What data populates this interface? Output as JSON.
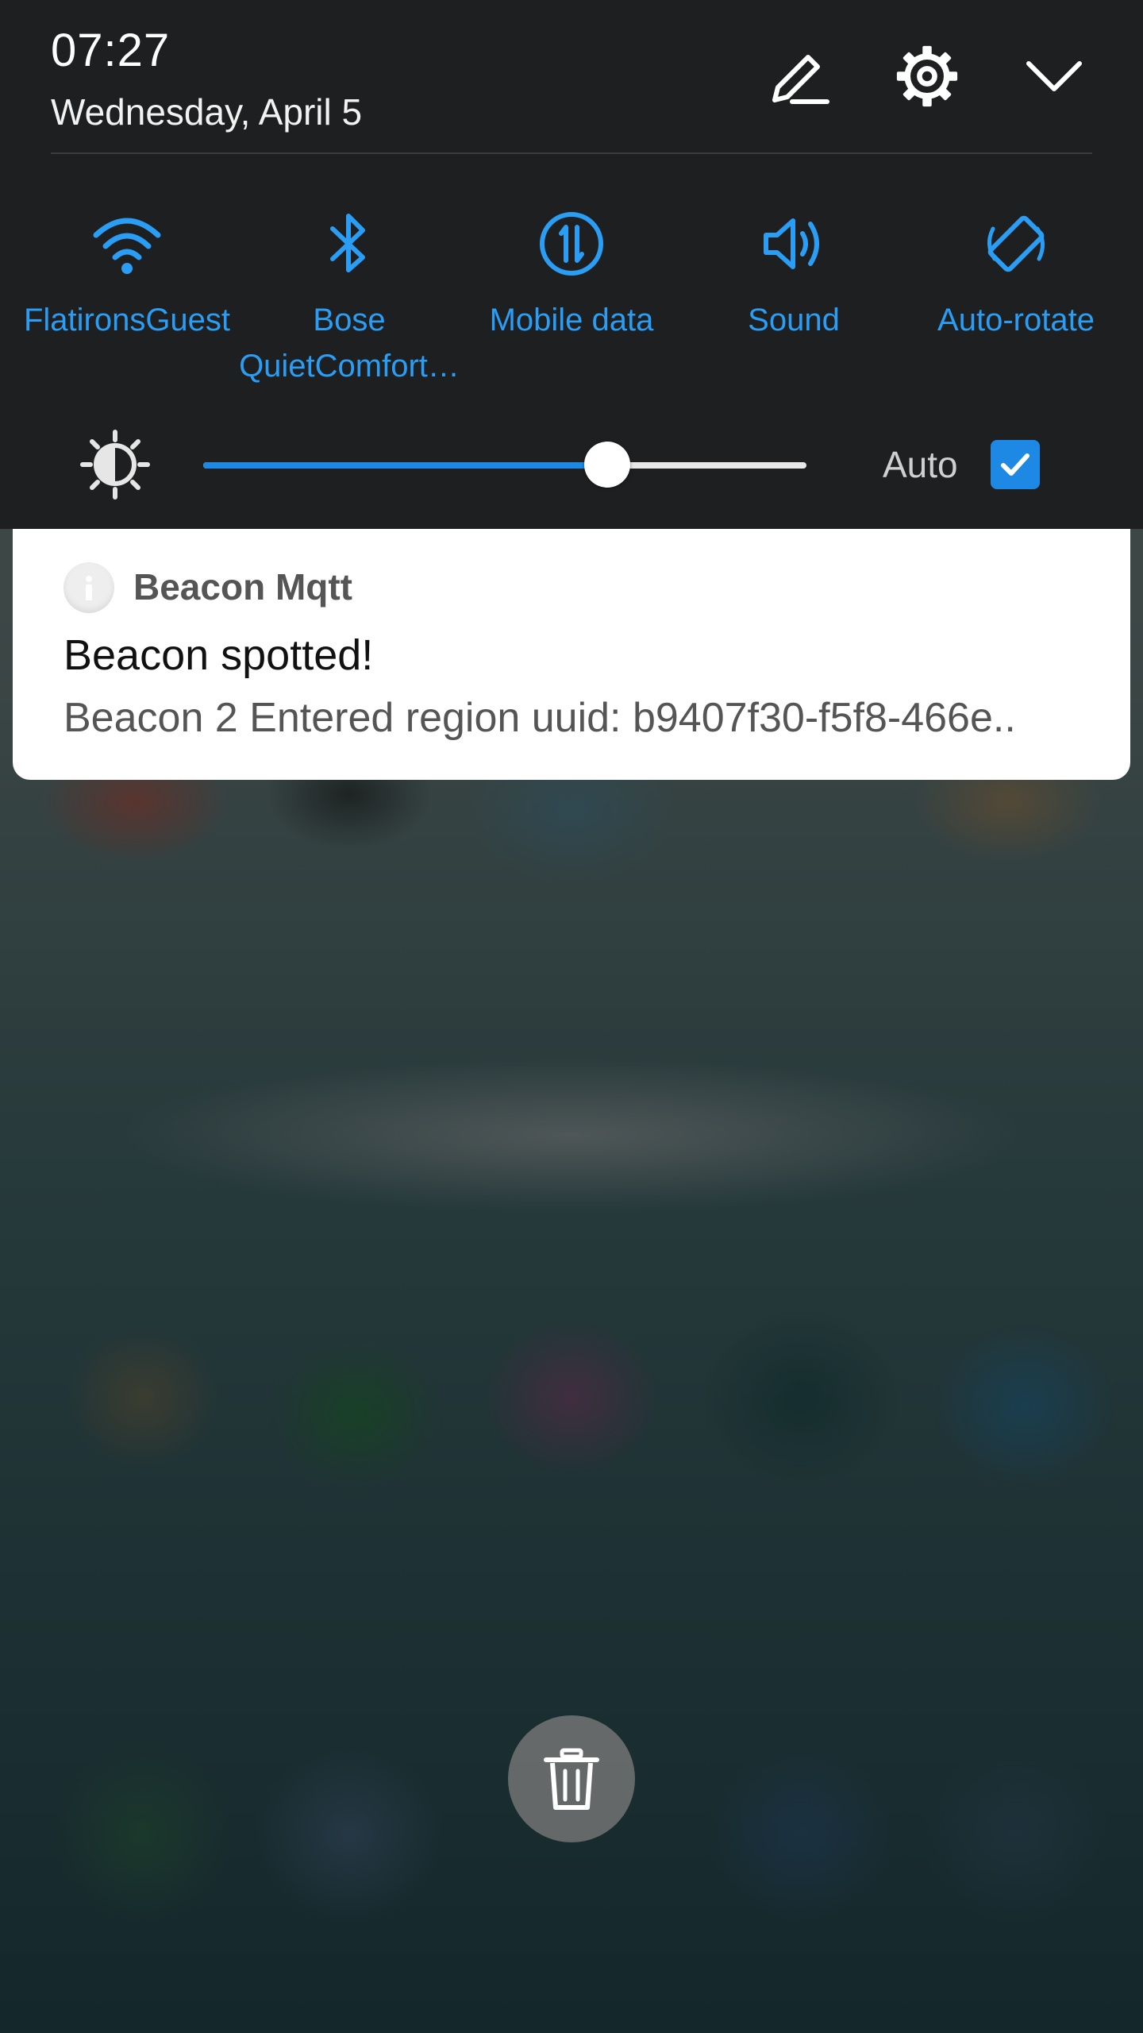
{
  "header": {
    "time": "07:27",
    "date": "Wednesday, April 5",
    "edit_icon": "pencil-edit-icon",
    "settings_icon": "gear-icon",
    "collapse_icon": "chevron-down-icon"
  },
  "quick_settings": {
    "accent_color": "#2a9df4",
    "tiles": [
      {
        "icon": "wifi-icon",
        "label_line1": "FlatironsGuest",
        "label_line2": ""
      },
      {
        "icon": "bluetooth-icon",
        "label_line1": "Bose",
        "label_line2": "QuietComfort…"
      },
      {
        "icon": "mobile-data-icon",
        "label_line1": "Mobile data",
        "label_line2": ""
      },
      {
        "icon": "sound-icon",
        "label_line1": "Sound",
        "label_line2": ""
      },
      {
        "icon": "auto-rotate-icon",
        "label_line1": "Auto-rotate",
        "label_line2": ""
      }
    ]
  },
  "brightness": {
    "icon": "brightness-icon",
    "level_fraction": 0.67,
    "auto_label": "Auto",
    "auto_checked": true
  },
  "notification": {
    "app_icon": "info-icon",
    "app_name": "Beacon Mqtt",
    "title": "Beacon spotted!",
    "body": "Beacon 2 Entered region uuid: b9407f30-f5f8-466e.."
  },
  "clear_all": {
    "icon": "trash-icon"
  }
}
